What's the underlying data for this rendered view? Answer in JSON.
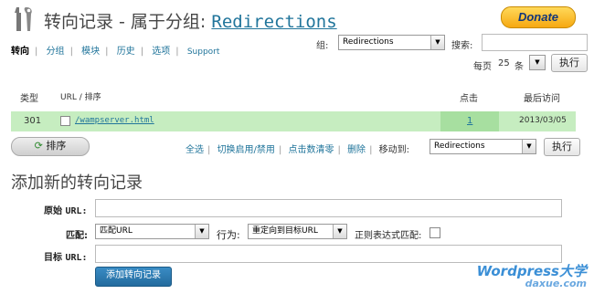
{
  "header": {
    "title": "转向记录 - 属于分组:",
    "group_name": "Redirections",
    "donate_label": "Donate"
  },
  "nav": {
    "items": [
      "转向",
      "分组",
      "模块",
      "历史",
      "选项",
      "Support"
    ]
  },
  "filter": {
    "group_label": "组:",
    "group_value": "Redirections",
    "search_label": "搜索:",
    "search_value": "",
    "per_page_prefix": "每页",
    "per_page_value": "25",
    "per_page_suffix": "条",
    "execute_label": "执行"
  },
  "table": {
    "columns": [
      "类型",
      "URL / 排序",
      "点击",
      "最后访问"
    ],
    "rows": [
      {
        "type": "301",
        "url": "/wampserver.html",
        "hits": "1",
        "last_access": "2013/03/05"
      }
    ]
  },
  "toolbar": {
    "sort_label": "排序",
    "links": [
      "全选",
      "切换启用/禁用",
      "点击数清零",
      "删除"
    ],
    "move_label": "移动到:",
    "move_value": "Redirections",
    "execute_label": "执行"
  },
  "add_form": {
    "title": "添加新的转向记录",
    "source_label": "原始",
    "source_suffix": "URL:",
    "source_value": "",
    "match_label": "匹配:",
    "match_value": "匹配URL",
    "action_label": "行为:",
    "action_value": "重定向到目标URL",
    "regex_label": "正则表达式匹配:",
    "target_label": "目标",
    "target_suffix": "URL:",
    "target_value": "",
    "submit_label": "添加转向记录"
  },
  "watermark": {
    "line1": "Wordpress大学",
    "line2": "daxue.com"
  }
}
